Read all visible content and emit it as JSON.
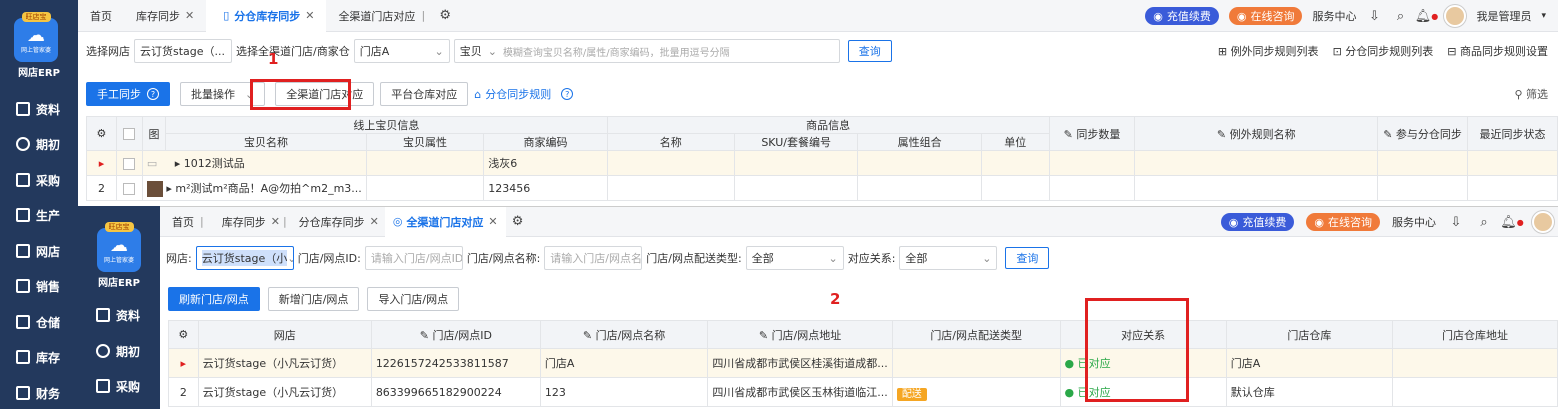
{
  "brand": {
    "logo_badge": "旺店宝",
    "logo_sub": "网上管家婆",
    "name": "网店ERP"
  },
  "sidebar1": [
    "资料",
    "期初",
    "采购",
    "生产",
    "网店",
    "销售",
    "仓储",
    "库存",
    "财务"
  ],
  "sidebar2": [
    "资料",
    "期初",
    "采购"
  ],
  "topbar1": {
    "tabs": [
      {
        "label": "首页",
        "closable": false,
        "active": false
      },
      {
        "label": "库存同步",
        "closable": true,
        "active": false
      },
      {
        "label": "分仓库存同步",
        "closable": true,
        "active": true
      },
      {
        "label": "全渠道门店对应",
        "closable": false,
        "active": false
      }
    ],
    "renew": "充值续费",
    "consult": "在线咨询",
    "service": "服务中心",
    "user": "我是管理员"
  },
  "filters1": {
    "shop_label": "选择网店",
    "shop_value": "云订货stage（...",
    "store_label": "选择全渠道门店/商家仓",
    "store_value": "门店A",
    "item_type": "宝贝",
    "item_placeholder": "模糊查询宝贝名称/属性/商家编码，批量用逗号分隔",
    "query": "查询",
    "links": [
      "例外同步规则列表",
      "分仓同步规则列表",
      "商品同步规则设置"
    ]
  },
  "actions1": {
    "manual_sync": "手工同步",
    "batch": "批量操作",
    "channel_store": "全渠道门店对应",
    "platform_wh": "平台仓库对应",
    "rule": "分仓同步规则",
    "filter": "筛选"
  },
  "annotations": {
    "one": "1",
    "two": "2"
  },
  "grid1": {
    "group_headers": {
      "online": "线上宝贝信息",
      "product": "商品信息"
    },
    "img_col": "图",
    "columns": [
      "宝贝名称",
      "宝贝属性",
      "商家编码",
      "名称",
      "SKU/套餐编号",
      "属性组合",
      "单位",
      "同步数量",
      "例外规则名称",
      "参与分仓同步",
      "最近同步状态"
    ],
    "rows": [
      {
        "idx": "",
        "name": "1012测试品",
        "attr": "",
        "code": "浅灰6"
      },
      {
        "idx": "2",
        "name": "m²测试m²商品！A@勿拍^m2_m3...",
        "attr": "",
        "code": "123456"
      }
    ]
  },
  "topbar2": {
    "tabs": [
      {
        "label": "首页",
        "closable": false,
        "active": false
      },
      {
        "label": "库存同步",
        "closable": true,
        "active": false
      },
      {
        "label": "分仓库存同步",
        "closable": true,
        "active": false
      },
      {
        "label": "全渠道门店对应",
        "closable": true,
        "active": true
      }
    ],
    "renew": "充值续费",
    "consult": "在线咨询",
    "service": "服务中心"
  },
  "filters2": {
    "shop_label": "网店:",
    "shop_value": "云订货stage（小",
    "id_label": "门店/网点ID:",
    "id_placeholder": "请输入门店/网点ID",
    "name_label": "门店/网点名称:",
    "name_placeholder": "请输入门店/网点名...",
    "type_label": "门店/网点配送类型:",
    "type_value": "全部",
    "rel_label": "对应关系:",
    "rel_value": "全部",
    "query": "查询"
  },
  "actions2": {
    "refresh": "刷新门店/网点",
    "add": "新增门店/网点",
    "import": "导入门店/网点"
  },
  "grid2": {
    "columns": [
      "网店",
      "门店/网点ID",
      "门店/网点名称",
      "门店/网点地址",
      "门店/网点配送类型",
      "对应关系",
      "门店仓库",
      "门店仓库地址"
    ],
    "rows": [
      {
        "idx": "",
        "shop": "云订货stage（小凡云订货）",
        "id": "1226157242533811587",
        "name": "门店A",
        "addr": "四川省成都市武侯区桂溪街道成都...",
        "type": "",
        "rel": "已对应",
        "wh": "门店A",
        "wh_addr": ""
      },
      {
        "idx": "2",
        "shop": "云订货stage（小凡云订货）",
        "id": "863399665182900224",
        "name": "123",
        "addr": "四川省成都市武侯区玉林街道临江...",
        "type": "配送",
        "rel": "已对应",
        "wh": "默认仓库",
        "wh_addr": ""
      }
    ]
  }
}
